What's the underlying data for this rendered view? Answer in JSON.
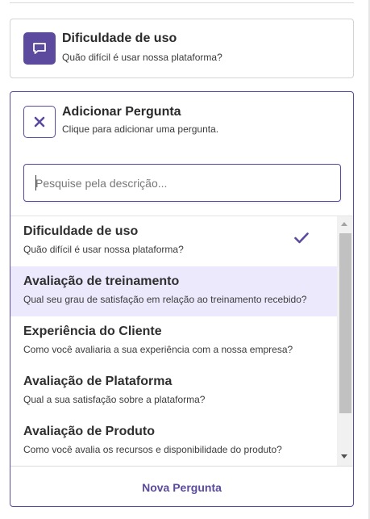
{
  "selected_question": {
    "icon": "chat-bubble-icon",
    "title": "Dificuldade de uso",
    "subtitle": "Quão difícil é usar nossa plataforma?"
  },
  "add_question": {
    "icon": "close-icon",
    "title": "Adicionar Pergunta",
    "subtitle": "Clique para adicionar uma pergunta."
  },
  "search": {
    "placeholder": "Pesquise pela descrição...",
    "value": ""
  },
  "options": [
    {
      "title": "Dificuldade de uso",
      "subtitle": "Quão difícil é usar nossa plataforma?",
      "selected": true,
      "highlighted": false
    },
    {
      "title": "Avaliação de treinamento",
      "subtitle": "Qual seu grau de satisfação em relação ao treinamento recebido?",
      "selected": false,
      "highlighted": true
    },
    {
      "title": "Experiência do Cliente",
      "subtitle": "Como você avaliaria a sua experiência com a nossa empresa?",
      "selected": false,
      "highlighted": false
    },
    {
      "title": "Avaliação de Plataforma",
      "subtitle": "Qual a sua satisfação sobre a plataforma?",
      "selected": false,
      "highlighted": false
    },
    {
      "title": "Avaliação de Produto",
      "subtitle": "Como você avalia os recursos e disponibilidade do produto?",
      "selected": false,
      "highlighted": false
    }
  ],
  "footer": {
    "new_question_label": "Nova Pergunta"
  },
  "colors": {
    "accent": "#5b4a9e",
    "highlight": "#ece9fc"
  }
}
